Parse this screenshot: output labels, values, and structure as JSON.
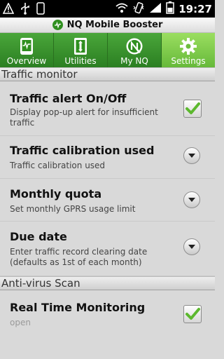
{
  "status_bar": {
    "time": "19:27",
    "left_icons": [
      "warning-icon",
      "usb-icon",
      "phone-icon"
    ],
    "right_icons": [
      "wifi-icon",
      "vibrate-icon",
      "signal-icon",
      "battery-icon"
    ]
  },
  "app": {
    "title": "NQ Mobile Booster"
  },
  "tabs": [
    {
      "label": "Overview",
      "icon": "phone-chart-icon"
    },
    {
      "label": "Utilities",
      "icon": "utilities-icon"
    },
    {
      "label": "My NQ",
      "icon": "nq-logo-icon"
    },
    {
      "label": "Settings",
      "icon": "gear-icon",
      "active": true
    }
  ],
  "sections": {
    "traffic": {
      "header": "Traffic monitor",
      "items": [
        {
          "title": "Traffic alert On/Off",
          "summary": "Display pop-up alert for insufficient traffic",
          "control": "checkbox",
          "checked": true
        },
        {
          "title": "Traffic calibration used",
          "summary": "Traffic calibration used",
          "control": "dropdown"
        },
        {
          "title": "Monthly quota",
          "summary": "Set monthly GPRS usage limit",
          "control": "dropdown"
        },
        {
          "title": "Due date",
          "summary": "Enter traffic record clearing date (defaults as 1st of each month)",
          "control": "dropdown"
        }
      ]
    },
    "antivirus": {
      "header": "Anti-virus Scan",
      "items": [
        {
          "title": "Real Time Monitoring",
          "summary": "open",
          "control": "checkbox",
          "checked": true
        }
      ]
    }
  },
  "colors": {
    "tab_green": "#2b7f22",
    "tab_active": "#7cc84a",
    "check_green": "#5cb82e"
  }
}
